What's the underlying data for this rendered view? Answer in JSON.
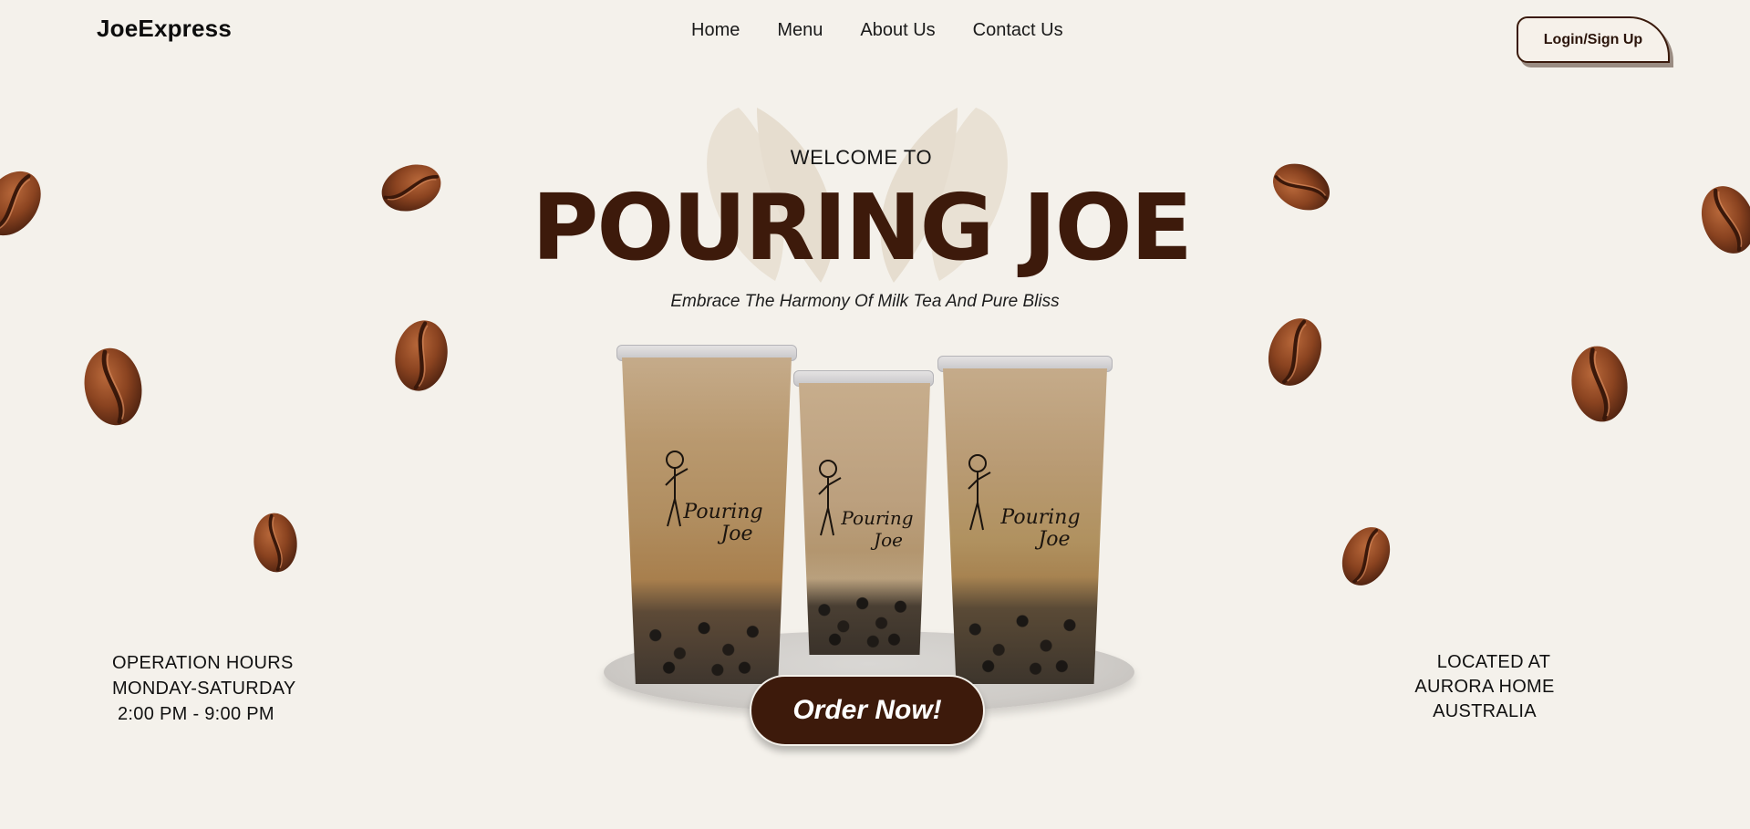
{
  "header": {
    "logo": "JoeExpress",
    "nav": [
      "Home",
      "Menu",
      "About Us",
      "Contact Us"
    ],
    "login_label": "Login/Sign Up"
  },
  "hero": {
    "welcome": "WELCOME TO",
    "title": "POURING JOE",
    "tagline": "Embrace The Harmony Of Milk Tea And Pure Bliss",
    "cup_brand_line1": "Pouring",
    "cup_brand_line2": "Joe",
    "order_label": "Order Now!"
  },
  "hours": {
    "heading": "OPERATION HOURS",
    "days": "MONDAY-SATURDAY",
    "time": "2:00 PM - 9:00 PM"
  },
  "location": {
    "heading": "LOCATED AT",
    "line1": "AURORA HOME",
    "line2": "AUSTRALIA"
  },
  "colors": {
    "background": "#f4f1eb",
    "brand_brown": "#3d1a0b",
    "bean": "#7a3a1a"
  },
  "decor": {
    "icons": [
      "coffee-bean-icon",
      "coffee-leaf-icon"
    ]
  }
}
